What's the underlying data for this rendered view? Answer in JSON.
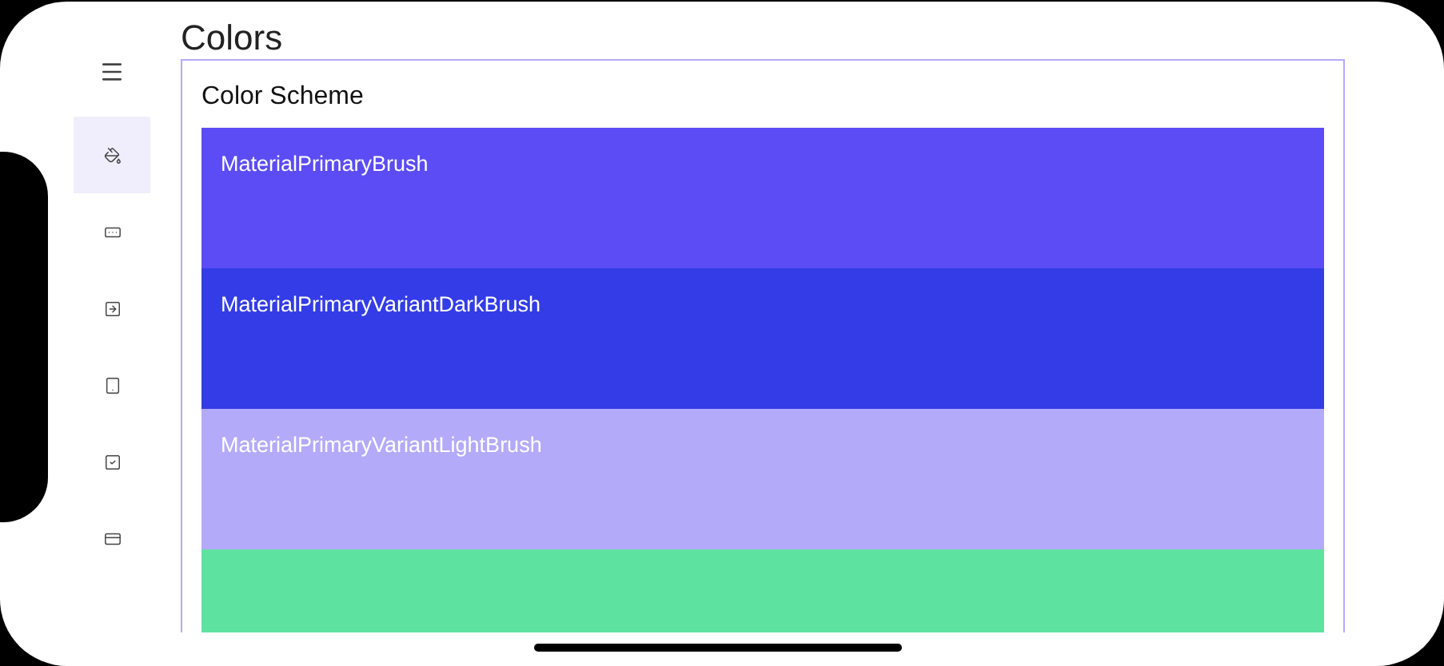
{
  "sidebar": {
    "items": [
      {
        "kind": "paint",
        "selected": true
      },
      {
        "kind": "ruler",
        "selected": false
      },
      {
        "kind": "entry",
        "selected": false
      },
      {
        "kind": "device",
        "selected": false
      },
      {
        "kind": "check",
        "selected": false
      },
      {
        "kind": "card",
        "selected": false
      }
    ]
  },
  "page": {
    "title": "Colors"
  },
  "card": {
    "title": "Color Scheme",
    "swatches": [
      {
        "name": "MaterialPrimaryBrush",
        "color": "#5b4cf5"
      },
      {
        "name": "MaterialPrimaryVariantDarkBrush",
        "color": "#333ce6"
      },
      {
        "name": "MaterialPrimaryVariantLightBrush",
        "color": "#b4aafa"
      },
      {
        "color": "#5ee2a0"
      }
    ]
  }
}
